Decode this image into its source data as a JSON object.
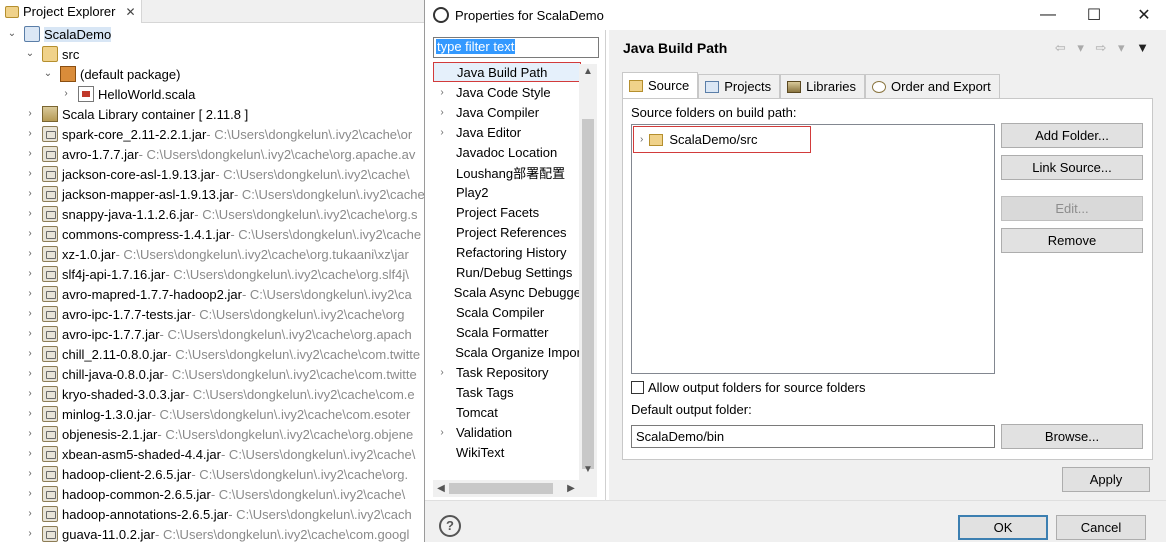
{
  "project_explorer": {
    "tab_label": "Project Explorer",
    "close_glyph": "✕",
    "rows": [
      {
        "level": 0,
        "chev": "⌄",
        "icon": "project-icon",
        "label": "ScalaDemo",
        "path": "",
        "selected": true
      },
      {
        "level": 1,
        "chev": "⌄",
        "icon": "source-folder-icon",
        "label": "src",
        "path": ""
      },
      {
        "level": 2,
        "chev": "⌄",
        "icon": "package-icon",
        "label": "(default package)",
        "path": ""
      },
      {
        "level": 3,
        "chev": "›",
        "icon": "scala-file-icon",
        "label": "HelloWorld.scala",
        "path": ""
      },
      {
        "level": 1,
        "chev": "›",
        "icon": "library-icon",
        "label": "Scala Library container [ 2.11.8 ]",
        "path": ""
      },
      {
        "level": 1,
        "chev": "›",
        "icon": "jar-icon",
        "label": "spark-core_2.11-2.2.1.jar",
        "path": " - C:\\Users\\dongkelun\\.ivy2\\cache\\or"
      },
      {
        "level": 1,
        "chev": "›",
        "icon": "jar-icon",
        "label": "avro-1.7.7.jar",
        "path": " - C:\\Users\\dongkelun\\.ivy2\\cache\\org.apache.av"
      },
      {
        "level": 1,
        "chev": "›",
        "icon": "jar-icon",
        "label": "jackson-core-asl-1.9.13.jar",
        "path": " - C:\\Users\\dongkelun\\.ivy2\\cache\\"
      },
      {
        "level": 1,
        "chev": "›",
        "icon": "jar-icon",
        "label": "jackson-mapper-asl-1.9.13.jar",
        "path": " - C:\\Users\\dongkelun\\.ivy2\\cache"
      },
      {
        "level": 1,
        "chev": "›",
        "icon": "jar-icon",
        "label": "snappy-java-1.1.2.6.jar",
        "path": " - C:\\Users\\dongkelun\\.ivy2\\cache\\org.s"
      },
      {
        "level": 1,
        "chev": "›",
        "icon": "jar-icon",
        "label": "commons-compress-1.4.1.jar",
        "path": " - C:\\Users\\dongkelun\\.ivy2\\cache"
      },
      {
        "level": 1,
        "chev": "›",
        "icon": "jar-icon",
        "label": "xz-1.0.jar",
        "path": " - C:\\Users\\dongkelun\\.ivy2\\cache\\org.tukaani\\xz\\jar"
      },
      {
        "level": 1,
        "chev": "›",
        "icon": "jar-icon",
        "label": "slf4j-api-1.7.16.jar",
        "path": " - C:\\Users\\dongkelun\\.ivy2\\cache\\org.slf4j\\"
      },
      {
        "level": 1,
        "chev": "›",
        "icon": "jar-icon",
        "label": "avro-mapred-1.7.7-hadoop2.jar",
        "path": " - C:\\Users\\dongkelun\\.ivy2\\ca"
      },
      {
        "level": 1,
        "chev": "›",
        "icon": "jar-icon",
        "label": "avro-ipc-1.7.7-tests.jar",
        "path": " - C:\\Users\\dongkelun\\.ivy2\\cache\\org"
      },
      {
        "level": 1,
        "chev": "›",
        "icon": "jar-icon",
        "label": "avro-ipc-1.7.7.jar",
        "path": " - C:\\Users\\dongkelun\\.ivy2\\cache\\org.apach"
      },
      {
        "level": 1,
        "chev": "›",
        "icon": "jar-icon",
        "label": "chill_2.11-0.8.0.jar",
        "path": " - C:\\Users\\dongkelun\\.ivy2\\cache\\com.twitte"
      },
      {
        "level": 1,
        "chev": "›",
        "icon": "jar-icon",
        "label": "chill-java-0.8.0.jar",
        "path": " - C:\\Users\\dongkelun\\.ivy2\\cache\\com.twitte"
      },
      {
        "level": 1,
        "chev": "›",
        "icon": "jar-icon",
        "label": "kryo-shaded-3.0.3.jar",
        "path": " - C:\\Users\\dongkelun\\.ivy2\\cache\\com.e"
      },
      {
        "level": 1,
        "chev": "›",
        "icon": "jar-icon",
        "label": "minlog-1.3.0.jar",
        "path": " - C:\\Users\\dongkelun\\.ivy2\\cache\\com.esoter"
      },
      {
        "level": 1,
        "chev": "›",
        "icon": "jar-icon",
        "label": "objenesis-2.1.jar",
        "path": " - C:\\Users\\dongkelun\\.ivy2\\cache\\org.objene"
      },
      {
        "level": 1,
        "chev": "›",
        "icon": "jar-icon",
        "label": "xbean-asm5-shaded-4.4.jar",
        "path": " - C:\\Users\\dongkelun\\.ivy2\\cache\\"
      },
      {
        "level": 1,
        "chev": "›",
        "icon": "jar-icon",
        "label": "hadoop-client-2.6.5.jar",
        "path": " - C:\\Users\\dongkelun\\.ivy2\\cache\\org."
      },
      {
        "level": 1,
        "chev": "›",
        "icon": "jar-icon",
        "label": "hadoop-common-2.6.5.jar",
        "path": " - C:\\Users\\dongkelun\\.ivy2\\cache\\"
      },
      {
        "level": 1,
        "chev": "›",
        "icon": "jar-icon",
        "label": "hadoop-annotations-2.6.5.jar",
        "path": " - C:\\Users\\dongkelun\\.ivy2\\cach"
      },
      {
        "level": 1,
        "chev": "›",
        "icon": "jar-icon",
        "label": "guava-11.0.2.jar",
        "path": " - C:\\Users\\dongkelun\\.ivy2\\cache\\com.googl"
      }
    ]
  },
  "dialog": {
    "title": "Properties for ScalaDemo",
    "minimize": "—",
    "maximize": "☐",
    "close": "✕",
    "filter_placeholder": "type filter text",
    "nav_items": [
      {
        "label": "Java Build Path",
        "chev": "",
        "selected": true
      },
      {
        "label": "Java Code Style",
        "chev": "›"
      },
      {
        "label": "Java Compiler",
        "chev": "›"
      },
      {
        "label": "Java Editor",
        "chev": "›"
      },
      {
        "label": "Javadoc Location",
        "chev": ""
      },
      {
        "label": "Loushang部署配置",
        "chev": ""
      },
      {
        "label": "Play2",
        "chev": ""
      },
      {
        "label": "Project Facets",
        "chev": ""
      },
      {
        "label": "Project References",
        "chev": ""
      },
      {
        "label": "Refactoring History",
        "chev": ""
      },
      {
        "label": "Run/Debug Settings",
        "chev": ""
      },
      {
        "label": "Scala Async Debugge",
        "chev": ""
      },
      {
        "label": "Scala Compiler",
        "chev": ""
      },
      {
        "label": "Scala Formatter",
        "chev": ""
      },
      {
        "label": "Scala Organize Impor",
        "chev": ""
      },
      {
        "label": "Task Repository",
        "chev": "›"
      },
      {
        "label": "Task Tags",
        "chev": ""
      },
      {
        "label": "Tomcat",
        "chev": ""
      },
      {
        "label": "Validation",
        "chev": "›"
      },
      {
        "label": "WikiText",
        "chev": ""
      }
    ],
    "page_title": "Java Build Path",
    "page_nav_glyphs": "⇦ ▾ ⇨ ▾",
    "page_menu_glyph": "▼",
    "tabs": [
      {
        "label": "Source",
        "icon": "source-tab-icon",
        "active": true
      },
      {
        "label": "Projects",
        "icon": "projects-tab-icon"
      },
      {
        "label": "Libraries",
        "icon": "libraries-tab-icon"
      },
      {
        "label": "Order and Export",
        "icon": "order-tab-icon"
      }
    ],
    "source_label": "Source folders on build path:",
    "source_entry": "ScalaDemo/src",
    "buttons": {
      "add_folder": "Add Folder...",
      "link_source": "Link Source...",
      "edit": "Edit...",
      "remove": "Remove",
      "browse": "Browse...",
      "apply": "Apply",
      "ok": "OK",
      "cancel": "Cancel"
    },
    "allow_output": "Allow output folders for source folders",
    "default_output_label": "Default output folder:",
    "default_output_value": "ScalaDemo/bin",
    "help_glyph": "?"
  }
}
